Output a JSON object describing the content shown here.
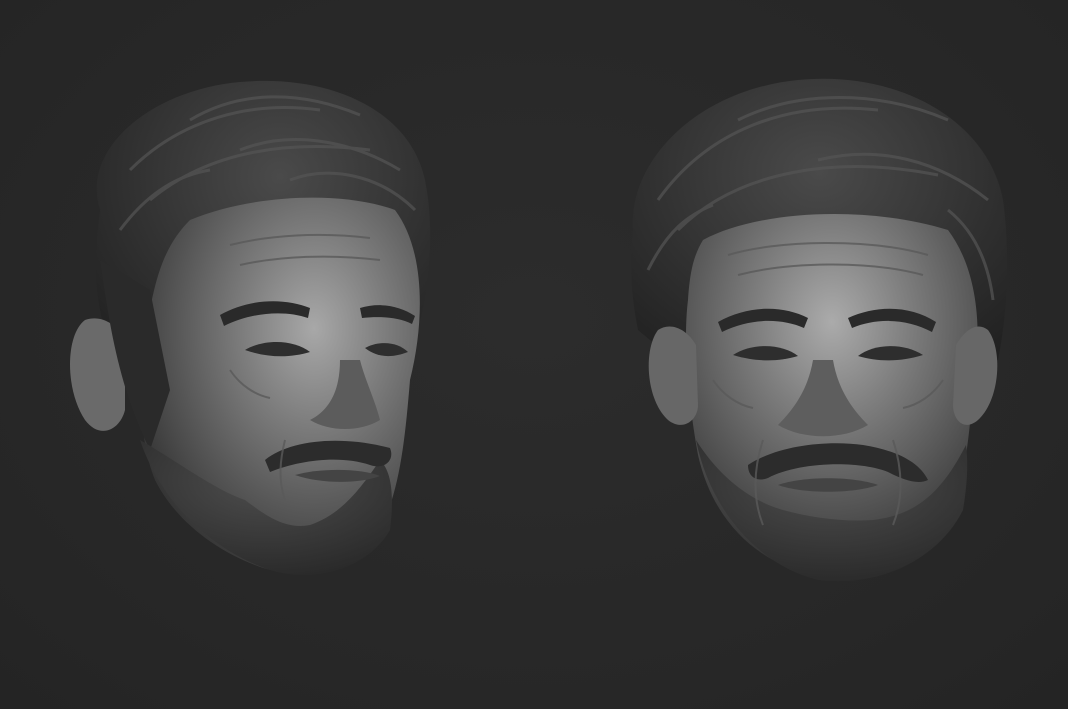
{
  "scene": {
    "background_color": "#282828",
    "objects": [
      {
        "name": "sculpted-head-three-quarter",
        "material": "matcap-gray"
      },
      {
        "name": "sculpted-head-frontal",
        "material": "matcap-gray"
      }
    ],
    "colors": {
      "clay_light": "#9a9a9a",
      "clay_mid": "#5a5a5a",
      "clay_dark": "#262626",
      "hair": "#2f2f2f"
    }
  }
}
